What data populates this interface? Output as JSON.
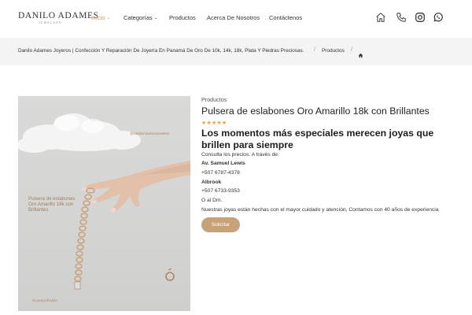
{
  "header": {
    "logo_main": "DANILO ADAMES",
    "logo_sub": "JEWELERS",
    "nav": [
      {
        "label": "Inicio",
        "has_dropdown": true,
        "active": true
      },
      {
        "label": "Categorías",
        "has_dropdown": true,
        "active": false
      },
      {
        "label": "Productos",
        "has_dropdown": false,
        "active": false
      },
      {
        "label": "Acerca De Nosotros",
        "has_dropdown": false,
        "active": false
      },
      {
        "label": "Contáctenos",
        "has_dropdown": false,
        "active": false
      }
    ],
    "icons": [
      "home-icon",
      "phone-icon",
      "instagram-icon",
      "whatsapp-icon"
    ],
    "accent_color": "#c9a06a"
  },
  "breadcrumb": {
    "root": "Danilo Adames Joyeros | Confección Y Reparación De Joyería En Panamá De Oro De 10k, 14k, 18k, Plata Y Piedras Preciosas.",
    "level2": "Productos",
    "separator": "/",
    "home_icon": "home-icon"
  },
  "product_image": {
    "tag_top": "@DaniloAdamesJewelers",
    "caption_lines": [
      "Pulsera de eslabones",
      "Oro Amarillo 18k con",
      "Brillantes"
    ],
    "tag_bottom": "#LuxuryLifestyle"
  },
  "product": {
    "category": "Productos",
    "title": "Pulsera de eslabones Oro Amarillo 18k con Brillantes",
    "rating_stars": "★★★★★",
    "rating": 5,
    "headline": "Los momentos más especiales merecen joyas que brillen para siempre",
    "info": {
      "consult": "Consulta los precios. A través de:",
      "loc1": "Av. Samuel Lewis",
      "phone1": "+507 6787-4378",
      "loc2": "Albrook",
      "phone2": "+507 6733-9353",
      "dm": "O al Dm.",
      "description": "Nuestras joyas están hechas con el mayor cuidado y atención, Contamos con 40 años de experiencia"
    },
    "button_label": "Solicitar",
    "button_color": "#c7a279"
  }
}
